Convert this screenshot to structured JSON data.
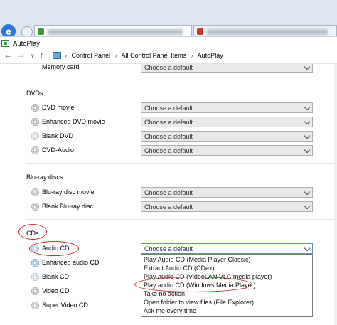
{
  "colors": {
    "annotation_red": "#d42020",
    "select_bg": "#e9e9e9",
    "dropdown_border": "#7a7a7a"
  },
  "window": {
    "title": "AutoPlay"
  },
  "nav": {
    "back_icon": "back-arrow-icon",
    "forward_icon": "forward-arrow-icon",
    "history_icon": "chevron-down-icon",
    "up_icon": "up-arrow-icon",
    "breadcrumbs": [
      "Control Panel",
      "All Control Panel Items",
      "AutoPlay"
    ]
  },
  "content": {
    "memory_card": {
      "label": "Memory card",
      "value": "Choose a default"
    },
    "dvds": {
      "heading": "DVDs",
      "items": [
        {
          "label": "DVD movie",
          "value": "Choose a default"
        },
        {
          "label": "Enhanced DVD movie",
          "value": "Choose a default"
        },
        {
          "label": "Blank DVD",
          "value": "Choose a default"
        },
        {
          "label": "DVD-Audio",
          "value": "Choose a default"
        }
      ]
    },
    "bluray": {
      "heading": "Blu-ray discs",
      "items": [
        {
          "label": "Blu-ray disc movie",
          "value": "Choose a default"
        },
        {
          "label": "Blank Blu-ray disc",
          "value": "Choose a default"
        }
      ]
    },
    "cds": {
      "heading": "CDs",
      "items": [
        {
          "label": "Audio CD",
          "value": "Choose a default"
        },
        {
          "label": "Enhanced audio CD"
        },
        {
          "label": "Blank CD"
        },
        {
          "label": "Video CD"
        },
        {
          "label": "Super Video CD"
        }
      ]
    }
  },
  "dropdown": {
    "options": [
      "Play Audio CD (Media Player Classic)",
      "Extract Audio CD (CDex)",
      "Play audio CD (VideoLAN VLC media player)",
      "Play audio CD (Windows Media Player)",
      "Take no action",
      "Open folder to view files (File Explorer)",
      "Ask me every time"
    ]
  }
}
